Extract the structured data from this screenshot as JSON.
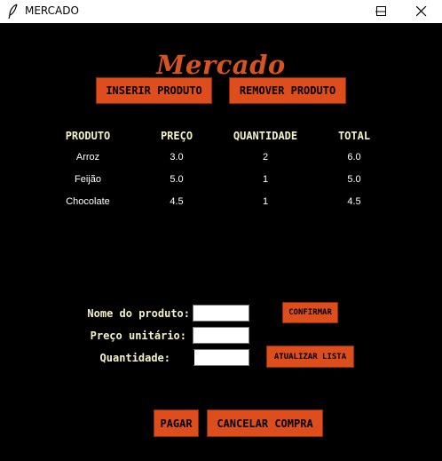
{
  "window": {
    "title": "MERCADO",
    "icon": "feather-icon"
  },
  "header": {
    "title": "Mercado"
  },
  "actions": {
    "insert_label": "INSERIR PRODUTO",
    "remove_label": "REMOVER PRODUTO"
  },
  "table": {
    "headers": [
      "PRODUTO",
      "PREÇO",
      "QUANTIDADE",
      "TOTAL"
    ],
    "rows": [
      [
        "Arroz",
        "3.0",
        "2",
        "6.0"
      ],
      [
        "Feijão",
        "5.0",
        "1",
        "5.0"
      ],
      [
        "Chocolate",
        "4.5",
        "1",
        "4.5"
      ]
    ]
  },
  "form": {
    "name_label": "Nome do produto:",
    "name_value": "",
    "price_label": "Preço unitário:",
    "price_value": "",
    "qty_label": "Quantidade:",
    "qty_value": "",
    "confirm_label": "CONFIRMAR",
    "update_label": "ATUALIZAR LISTA"
  },
  "footer": {
    "pay_label": "PAGAR",
    "cancel_label": "CANCELAR COMPRA"
  },
  "colors": {
    "accent": "#de4e1c",
    "heading": "#d9531e",
    "header_text": "#f4f2c6",
    "background": "#000000"
  }
}
